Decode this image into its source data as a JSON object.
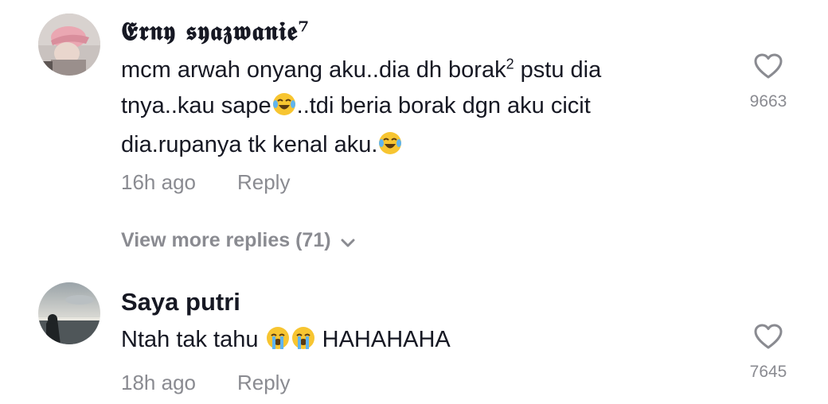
{
  "comments": [
    {
      "username": "𝕰𝖗𝖓𝖞 𝖘𝖞𝖆𝖟𝖜𝖆𝖓𝖎𝖊⁷",
      "text_line1_a": "mcm arwah onyang aku..dia dh borak",
      "text_line1_sup": "2",
      "text_line1_b": " pstu dia",
      "text_line2_a": "tnya..kau sape",
      "text_line2_b": "..tdi beria borak dgn aku cicit",
      "text_line3_a": "dia.rupanya tk kenal aku.",
      "time": "16h ago",
      "reply_label": "Reply",
      "likes": "9663",
      "avatar_icon": "avatar-photo-pink-cap"
    },
    {
      "username": "Saya putri",
      "text_a": "Ntah tak tahu ",
      "text_b": " HAHAHAHA",
      "time": "18h ago",
      "reply_label": "Reply",
      "likes": "7645",
      "avatar_icon": "avatar-photo-beach-sunset"
    }
  ],
  "view_more": {
    "label": "View more replies (71)"
  },
  "icons": {
    "like": "heart-outline-icon",
    "laugh": "face-with-tears-of-joy-emoji",
    "cry": "loudly-crying-face-emoji",
    "chevron": "chevron-down-icon"
  },
  "colors": {
    "primary_text": "#161823",
    "secondary_text": "#8a8b91"
  }
}
